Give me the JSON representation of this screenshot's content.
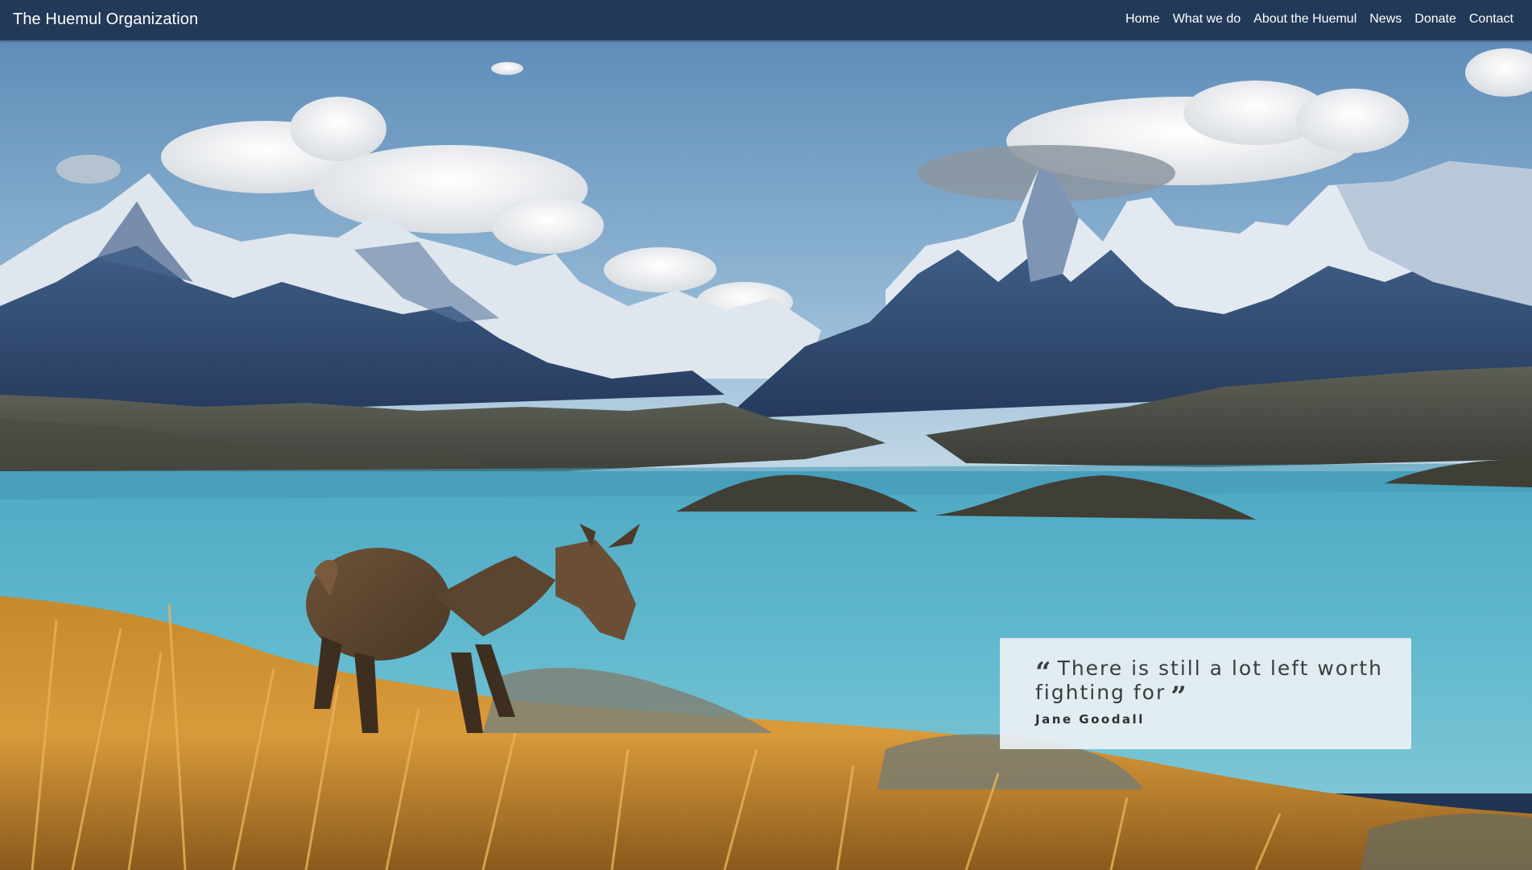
{
  "navbar": {
    "brand": "The Huemul Organization",
    "links": [
      "Home",
      "What we do",
      "About the Huemul",
      "News",
      "Donate",
      "Contact"
    ]
  },
  "hero": {
    "image_description_icon": "mountain-lake-deer-photo",
    "quote": {
      "open_mark": "“",
      "text": "There is still a lot left worth fighting for",
      "close_mark": "”",
      "author": "Jane Goodall"
    }
  },
  "colors": {
    "navbar_bg": "#223a57",
    "quote_box_bg": "#ebf0f3",
    "lake": "#5ab3c9"
  }
}
